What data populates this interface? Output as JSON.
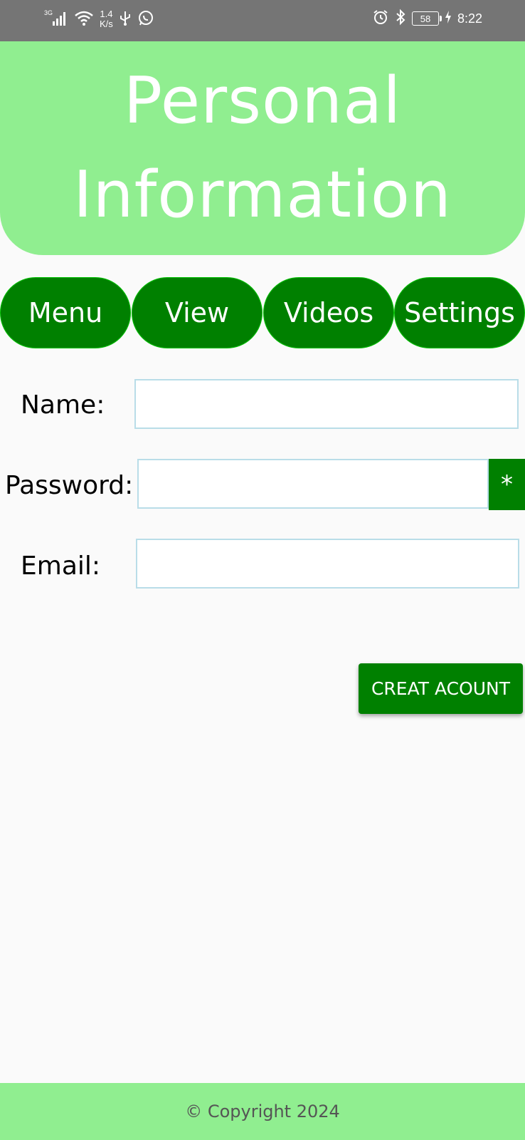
{
  "status_bar": {
    "signal_label": "3G",
    "net_speed_value": "1.4",
    "net_speed_unit": "K/s",
    "battery": "58",
    "time": "8:22"
  },
  "header": {
    "title_line1": "Personal",
    "title_line2": "Information"
  },
  "nav": {
    "items": [
      {
        "label": "Menu"
      },
      {
        "label": "View"
      },
      {
        "label": "Videos"
      },
      {
        "label": "Settings"
      }
    ]
  },
  "form": {
    "name_label": "Name:",
    "name_value": "",
    "password_label": "Password:",
    "password_value": "",
    "password_toggle": "*",
    "email_label": "Email:",
    "email_value": "",
    "submit_label": "CREAT ACOUNT"
  },
  "footer": {
    "copyright": "© Copyright 2024"
  },
  "colors": {
    "header_bg": "#90ee90",
    "primary": "#008000",
    "status_bar_bg": "#757575",
    "input_border": "#b9dde8"
  },
  "icons": {
    "status_left": [
      "signal-icon",
      "wifi-icon",
      "usb-icon",
      "whatsapp-icon"
    ],
    "status_right": [
      "alarm-icon",
      "bluetooth-icon",
      "battery-icon",
      "charging-icon"
    ]
  }
}
